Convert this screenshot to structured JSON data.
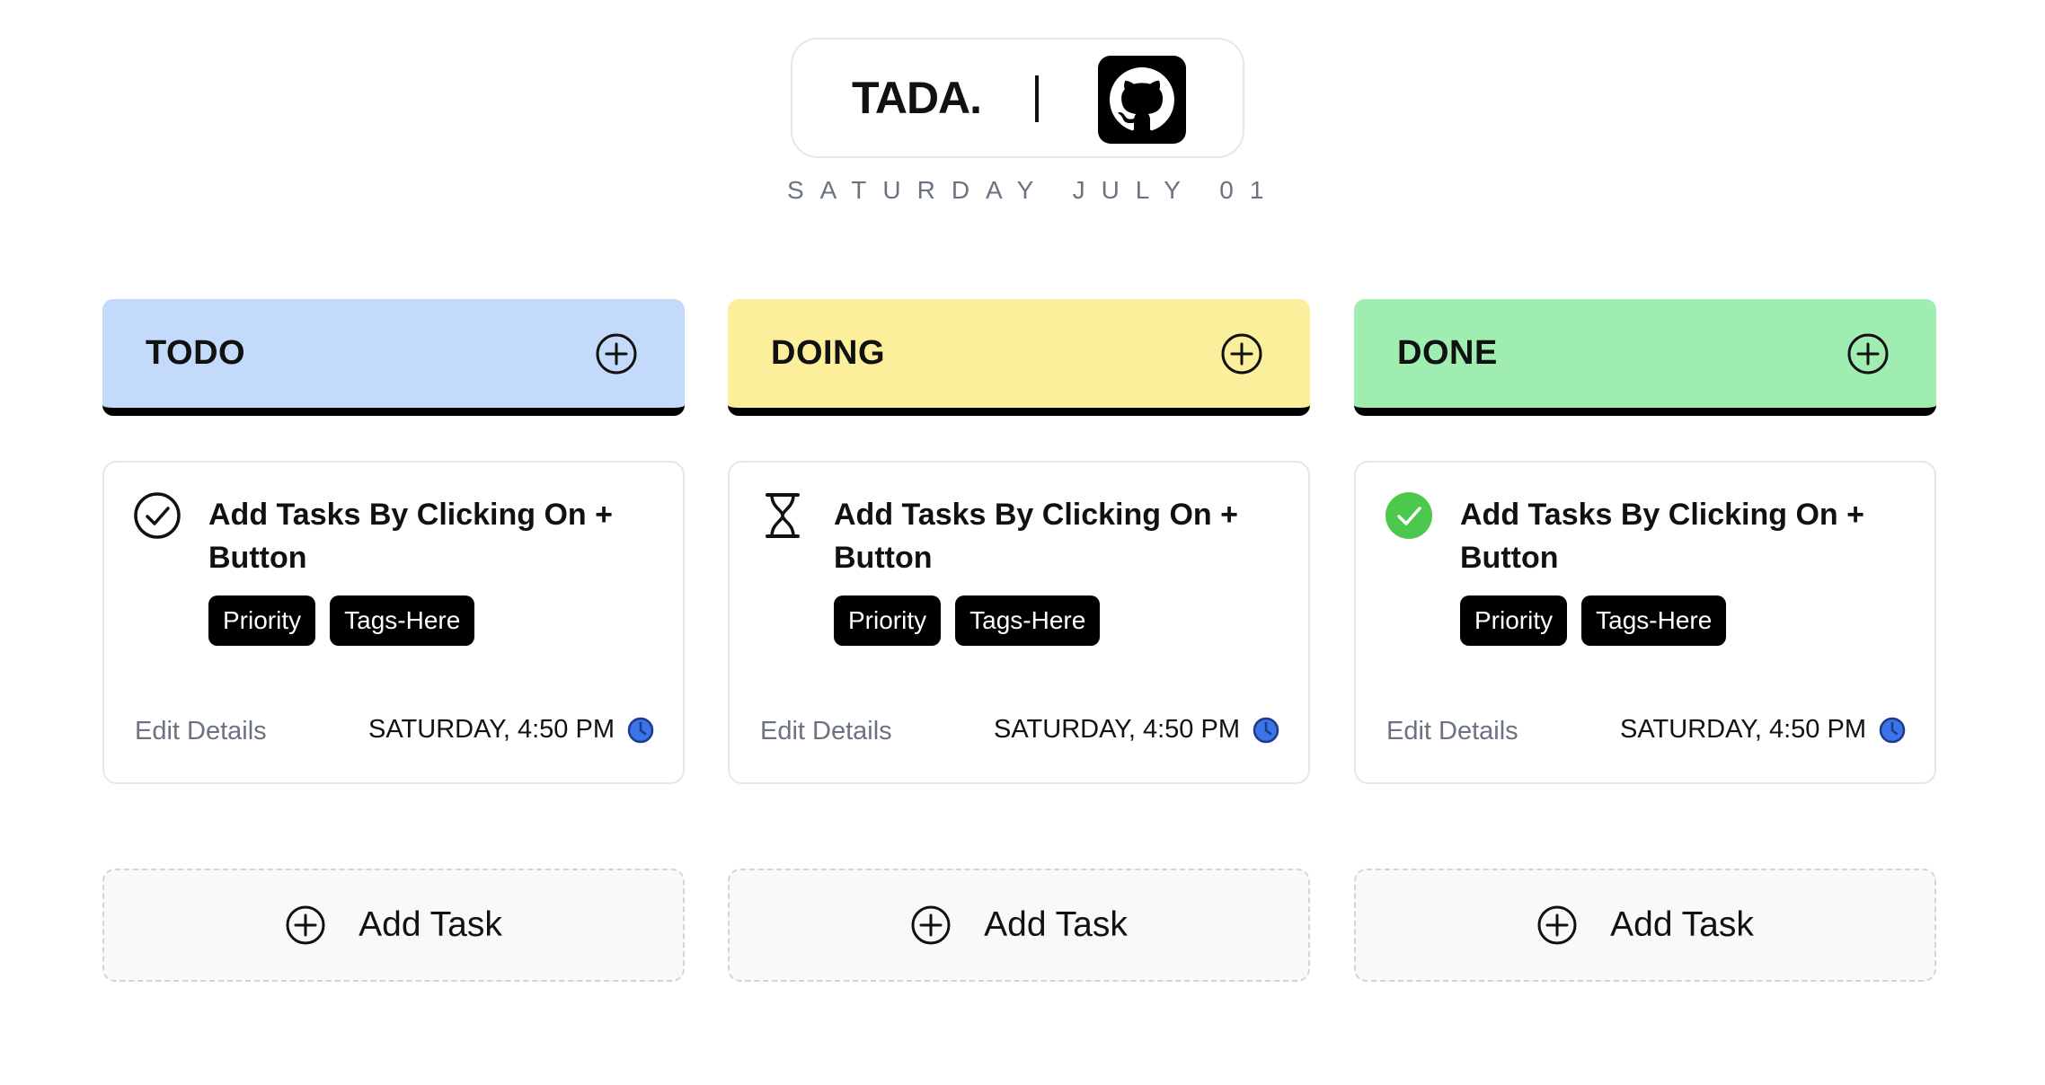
{
  "header": {
    "brand": "TADA.",
    "separator": "|",
    "github_icon": "github-icon",
    "date": "SATURDAY JULY 01"
  },
  "columns": [
    {
      "title": "TODO",
      "color": "#c3dafa",
      "add_icon": "plus-circle-icon",
      "card": {
        "status_icon": "check-circle-outline-icon",
        "title": "Add Tasks By Clicking On + Button",
        "tags": [
          "Priority",
          "Tags-Here"
        ],
        "edit": "Edit Details",
        "timestamp": "SATURDAY, 4:50 PM",
        "clock_icon": "clock-icon"
      },
      "add_task": "Add Task"
    },
    {
      "title": "DOING",
      "color": "#fbef9b",
      "add_icon": "plus-circle-icon",
      "card": {
        "status_icon": "hourglass-icon",
        "title": "Add Tasks By Clicking On + Button",
        "tags": [
          "Priority",
          "Tags-Here"
        ],
        "edit": "Edit Details",
        "timestamp": "SATURDAY, 4:50 PM",
        "clock_icon": "clock-icon"
      },
      "add_task": "Add Task"
    },
    {
      "title": "DONE",
      "color": "#a0edb1",
      "add_icon": "plus-circle-icon",
      "card": {
        "status_icon": "check-circle-filled-icon",
        "title": "Add Tasks By Clicking On + Button",
        "tags": [
          "Priority",
          "Tags-Here"
        ],
        "edit": "Edit Details",
        "timestamp": "SATURDAY, 4:50 PM",
        "clock_icon": "clock-icon"
      },
      "add_task": "Add Task"
    }
  ],
  "colors": {
    "tag_bg": "#000000",
    "done_green": "#4cc94c",
    "clock_blue": "#3b73e8",
    "muted_text": "#6b7280"
  }
}
